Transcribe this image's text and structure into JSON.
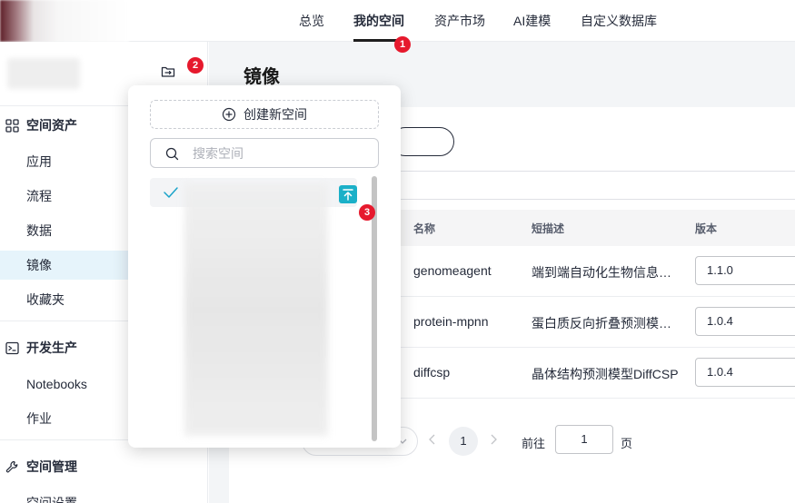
{
  "topnav": {
    "items": [
      {
        "label": "总览"
      },
      {
        "label": "我的空间"
      },
      {
        "label": "资产市场"
      },
      {
        "label": "AI建模"
      },
      {
        "label": "自定义数据库"
      }
    ]
  },
  "badges": {
    "b1": "1",
    "b2": "2",
    "b3": "3"
  },
  "sidebar": {
    "group_assets": "空间资产",
    "assets_items": [
      {
        "label": "应用"
      },
      {
        "label": "流程"
      },
      {
        "label": "数据"
      },
      {
        "label": "镜像"
      },
      {
        "label": "收藏夹"
      }
    ],
    "group_dev": "开发生产",
    "dev_items": [
      {
        "label": "Notebooks"
      },
      {
        "label": "作业"
      }
    ],
    "group_manage": "空间管理",
    "manage_items": [
      {
        "label": "空间设置"
      }
    ]
  },
  "main": {
    "title": "镜像",
    "table": {
      "headers": [
        "名称",
        "短描述",
        "版本"
      ],
      "rows": [
        {
          "name": "genomeagent",
          "desc": "端到端自动化生物信息…",
          "version": "1.1.0"
        },
        {
          "name": "protein-mpnn",
          "desc": "蛋白质反向折叠预测模…",
          "version": "1.0.4"
        },
        {
          "name": "diffcsp",
          "desc": "晶体结构预测模型DiffCSP",
          "version": "1.0.4"
        }
      ]
    },
    "pagination": {
      "current": "1",
      "goto_label": "前往",
      "goto_value": "1",
      "page_label": "页"
    }
  },
  "dropdown": {
    "create_label": "创建新空间",
    "search_placeholder": "搜索空间"
  },
  "colors": {
    "accent_pin": "#1bb0c8",
    "check": "#1aa3c9",
    "badge": "#e6192d",
    "active_bg": "#e6f4fb"
  }
}
